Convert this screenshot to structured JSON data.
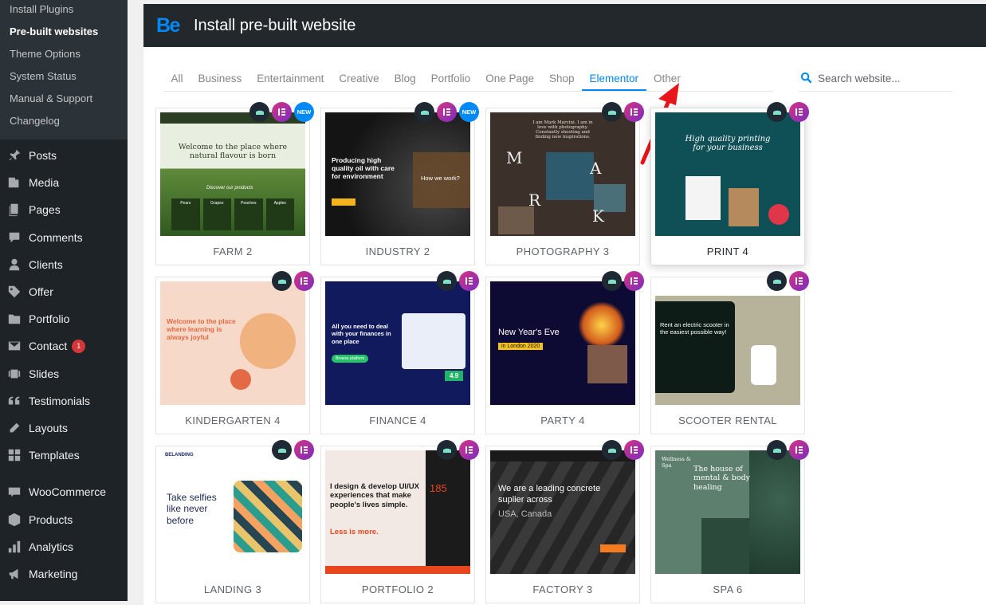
{
  "sidebar": {
    "sub_items": [
      {
        "label": "Install Plugins",
        "active": false
      },
      {
        "label": "Pre-built websites",
        "active": true
      },
      {
        "label": "Theme Options",
        "active": false
      },
      {
        "label": "System Status",
        "active": false
      },
      {
        "label": "Manual & Support",
        "active": false
      },
      {
        "label": "Changelog",
        "active": false
      }
    ],
    "menu": [
      {
        "label": "Posts",
        "icon": "pin-icon"
      },
      {
        "label": "Media",
        "icon": "media-icon"
      },
      {
        "label": "Pages",
        "icon": "pages-icon"
      },
      {
        "label": "Comments",
        "icon": "comment-icon"
      },
      {
        "label": "Clients",
        "icon": "user-icon"
      },
      {
        "label": "Offer",
        "icon": "tag-icon"
      },
      {
        "label": "Portfolio",
        "icon": "folder-icon"
      },
      {
        "label": "Contact",
        "icon": "mail-icon",
        "badge": "1"
      },
      {
        "label": "Slides",
        "icon": "slides-icon"
      },
      {
        "label": "Testimonials",
        "icon": "quote-icon"
      },
      {
        "label": "Layouts",
        "icon": "edit-icon"
      },
      {
        "label": "Templates",
        "icon": "grid-icon"
      },
      {
        "label": "WooCommerce",
        "icon": "woo-icon"
      },
      {
        "label": "Products",
        "icon": "box-icon"
      },
      {
        "label": "Analytics",
        "icon": "chart-icon"
      },
      {
        "label": "Marketing",
        "icon": "megaphone-icon"
      }
    ]
  },
  "header": {
    "logo": "Be",
    "title": "Install pre-built website"
  },
  "tabs": [
    "All",
    "Business",
    "Entertainment",
    "Creative",
    "Blog",
    "Portfolio",
    "One Page",
    "Shop",
    "Elementor",
    "Other"
  ],
  "active_tab": "Elementor",
  "search": {
    "placeholder": "Search website..."
  },
  "badge_new": "NEW",
  "colors": {
    "accent": "#0089f7",
    "annotation_arrow": "#e8151b"
  },
  "websites": [
    {
      "name": "FARM 2",
      "new": true,
      "thumb": {
        "title": "Welcome to the place where natural flavour is born",
        "sub": "Discover our products",
        "labels": [
          "Pears",
          "Grapes",
          "Peaches",
          "Apples"
        ]
      }
    },
    {
      "name": "INDUSTRY 2",
      "new": true,
      "thumb": {
        "title": "Producing high quality oil with care for environment",
        "sub": "How we work?"
      }
    },
    {
      "name": "PHOTOGRAPHY 3",
      "thumb": {
        "title": "I am Mark Marcini. I am in love with photography. Constantly shooting and finding new inspirations.",
        "letters": [
          "M",
          "A",
          "R",
          "K"
        ]
      }
    },
    {
      "name": "PRINT 4",
      "highlight": true,
      "thumb": {
        "title": "High quality printing for your business"
      }
    },
    {
      "name": "KINDERGARTEN 4",
      "thumb": {
        "title": "Welcome to the place where learning is always joyful"
      }
    },
    {
      "name": "FINANCE 4",
      "thumb": {
        "title": "All you need to deal with your finances in one place",
        "sub": "Browse platform",
        "value": "4.9"
      }
    },
    {
      "name": "PARTY 4",
      "thumb": {
        "title": "New Year's Eve",
        "sub": "in London 2020"
      }
    },
    {
      "name": "SCOOTER RENTAL",
      "thumb": {
        "title": "Rent an electric scooter in the easiest possible way!"
      }
    },
    {
      "name": "LANDING 3",
      "thumb": {
        "title": "Take selfies like never before",
        "brand": "BELANDING"
      }
    },
    {
      "name": "PORTFOLIO 2",
      "thumb": {
        "title": "I design & develop UI/UX experiences that make people's lives simple.",
        "accent": "Less is more.",
        "value": "185"
      }
    },
    {
      "name": "FACTORY 3",
      "thumb": {
        "title": "We are a leading concrete suplier across",
        "sub": "USA, Canada"
      }
    },
    {
      "name": "SPA 6",
      "thumb": {
        "title": "The house of mental & body healing",
        "brand": "Wellness & Spa"
      }
    }
  ]
}
